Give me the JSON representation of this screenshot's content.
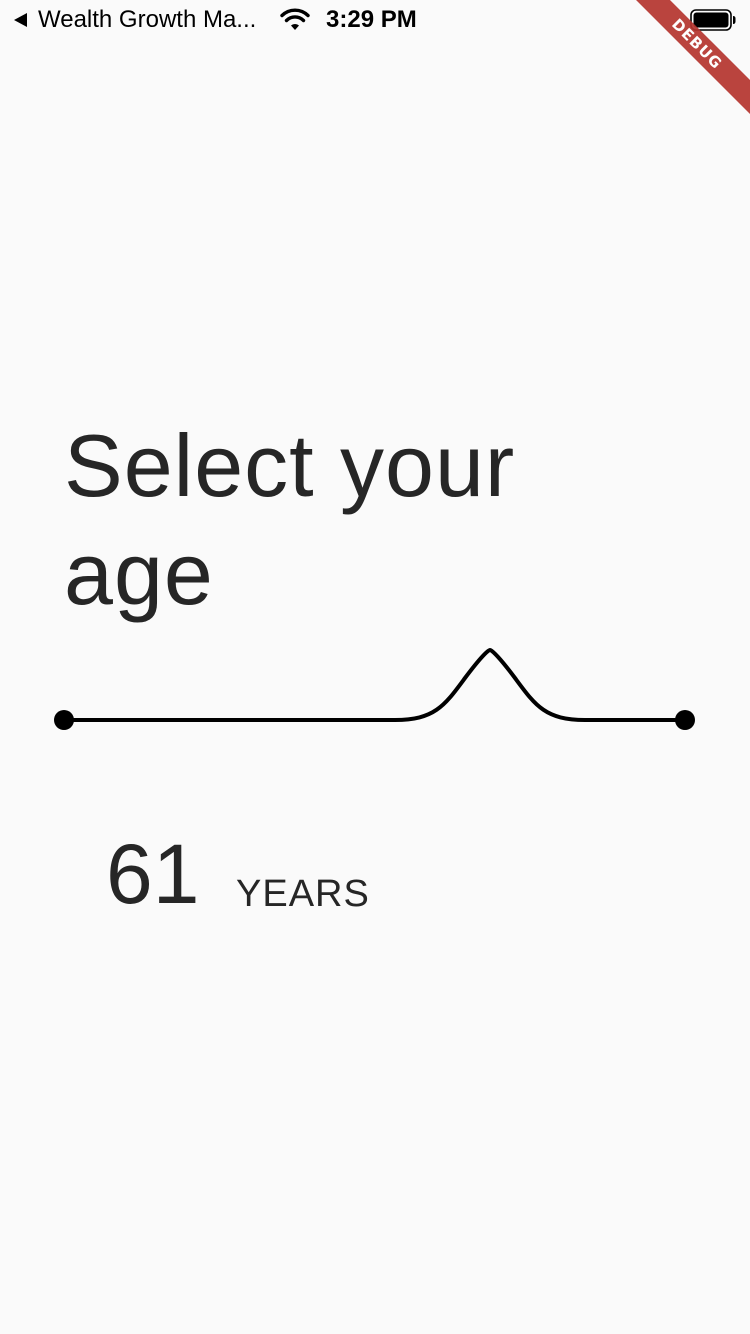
{
  "status_bar": {
    "back_app": "Wealth Growth Ma...",
    "time": "3:29 PM",
    "back_icon": "back-arrow-icon",
    "wifi_icon": "wifi-icon",
    "battery_icon": "battery-icon"
  },
  "debug_banner": "DEBUG",
  "page": {
    "title": "Select your age",
    "age_value": "61",
    "age_unit": "YEARS"
  },
  "slider": {
    "track_color": "#000000",
    "knob_position": 0.69
  },
  "colors": {
    "background": "#fafafa",
    "text": "#262626",
    "debug_ribbon": "#b5352f"
  }
}
